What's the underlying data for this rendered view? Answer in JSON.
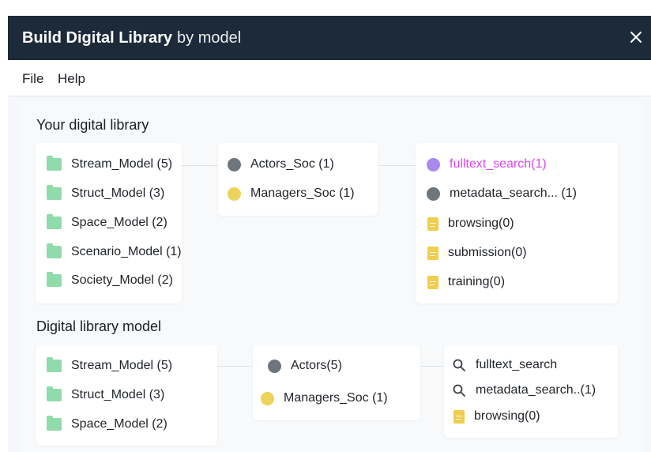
{
  "window": {
    "title_main": "Build Digital Library",
    "title_suffix": "by model"
  },
  "menu": {
    "file": "File",
    "help": "Help"
  },
  "colors": {
    "titlebar_bg": "#1c2a3a",
    "folder_green": "#8fdcaa",
    "actor_gray": "#6e757c",
    "manager_yellow": "#ecd35a",
    "highlight_purple": "#a989f0",
    "highlight_text": "#d946ef",
    "doc_yellow": "#f1cd4d"
  },
  "library": {
    "title": "Your digital library",
    "models": [
      {
        "label": "Stream_Model (5)",
        "icon": "folder-icon"
      },
      {
        "label": "Struct_Model (3)",
        "icon": "folder-icon"
      },
      {
        "label": "Space_Model (2)",
        "icon": "folder-icon"
      },
      {
        "label": "Scenario_Model (1)",
        "icon": "folder-icon"
      },
      {
        "label": "Society_Model (2)",
        "icon": "folder-icon"
      }
    ],
    "societies": [
      {
        "label": "Actors_Soc (1)",
        "icon": "gray-dot-icon"
      },
      {
        "label": "Managers_Soc (1)",
        "icon": "yellow-dot-icon"
      }
    ],
    "services": [
      {
        "label": "fulltext_search(1)",
        "icon": "purple-dot-icon",
        "highlighted": true
      },
      {
        "label": "metadata_search... (1)",
        "icon": "gray-dot-icon"
      },
      {
        "label": "browsing(0)",
        "icon": "document-icon"
      },
      {
        "label": "submission(0)",
        "icon": "document-icon"
      },
      {
        "label": "training(0)",
        "icon": "document-icon"
      }
    ]
  },
  "model": {
    "title": "Digital library model",
    "models": [
      {
        "label": "Stream_Model (5)",
        "icon": "folder-icon"
      },
      {
        "label": "Struct_Model (3)",
        "icon": "folder-icon"
      },
      {
        "label": "Space_Model (2)",
        "icon": "folder-icon"
      }
    ],
    "societies": [
      {
        "label": "Actors(5)",
        "icon": "gray-dot-icon"
      },
      {
        "label": "Managers_Soc (1)",
        "icon": "yellow-dot-icon"
      }
    ],
    "services": [
      {
        "label": "fulltext_search",
        "icon": "magnifier-icon"
      },
      {
        "label": "metadata_search..(1)",
        "icon": "magnifier-icon"
      },
      {
        "label": "browsing(0)",
        "icon": "document-icon"
      }
    ]
  }
}
